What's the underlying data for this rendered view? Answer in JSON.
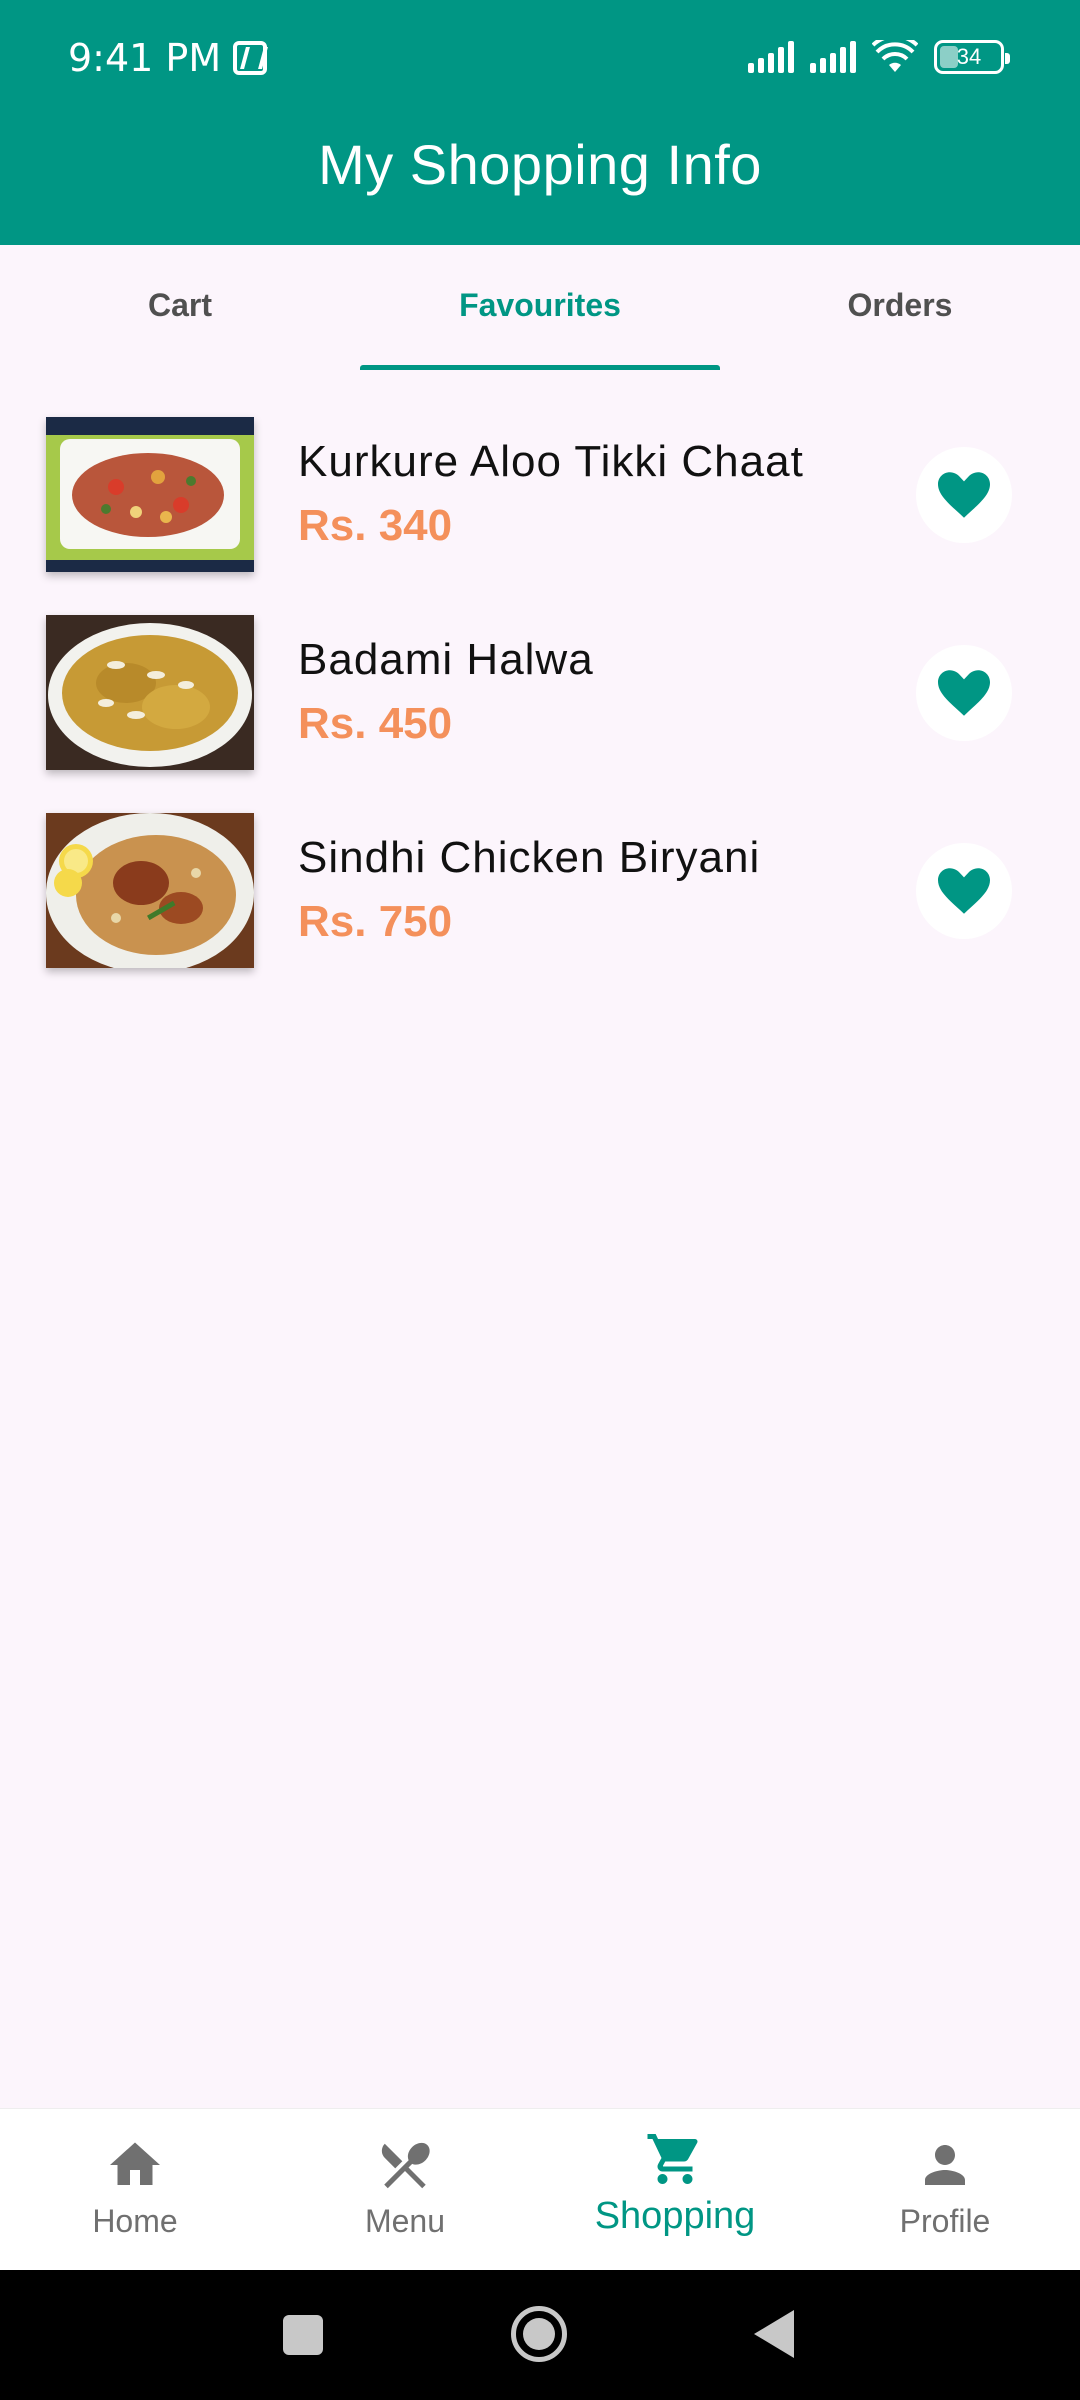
{
  "status_bar": {
    "time": "9:41 PM",
    "battery": "34",
    "icons": [
      "nfc-icon",
      "signal-icon",
      "signal-icon",
      "wifi-icon",
      "battery-icon"
    ]
  },
  "header": {
    "title": "My Shopping Info"
  },
  "tabs": [
    {
      "label": "Cart",
      "active": false
    },
    {
      "label": "Favourites",
      "active": true
    },
    {
      "label": "Orders",
      "active": false
    }
  ],
  "favourites": [
    {
      "name": "Kurkure Aloo Tikki Chaat",
      "price": "Rs. 340",
      "icon": "heart-icon"
    },
    {
      "name": "Badami Halwa",
      "price": "Rs. 450",
      "icon": "heart-icon"
    },
    {
      "name": "Sindhi Chicken Biryani",
      "price": "Rs. 750",
      "icon": "heart-icon"
    }
  ],
  "bottom_nav": [
    {
      "label": "Home",
      "icon": "home-icon",
      "active": false
    },
    {
      "label": "Menu",
      "icon": "fork-spoon-icon",
      "active": false
    },
    {
      "label": "Shopping",
      "icon": "cart-icon",
      "active": true
    },
    {
      "label": "Profile",
      "icon": "person-icon",
      "active": false
    }
  ],
  "colors": {
    "primary": "#009684",
    "price": "#f4905b",
    "background": "#fcf5fc",
    "nav_inactive": "#707070"
  }
}
